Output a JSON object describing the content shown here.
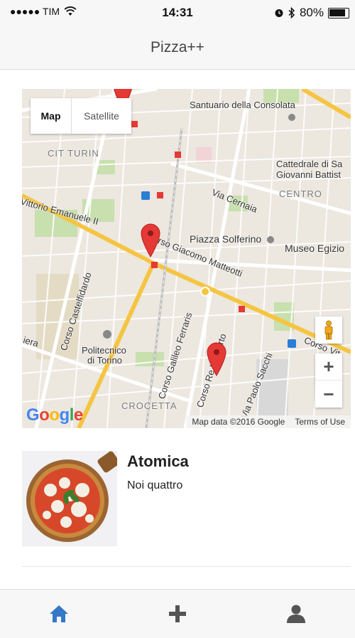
{
  "status_bar": {
    "signal": "●●●●● TIM",
    "time": "14:31",
    "battery": "80%"
  },
  "nav": {
    "title": "Pizza++"
  },
  "map": {
    "map_types": [
      "Map",
      "Satellite"
    ],
    "selected_type": "Map",
    "labels": {
      "consolata": "Santuario della Consolata",
      "cit_turin": "CIT TURIN",
      "cattedrale": "Cattedrale di Sa",
      "giovanni": "Giovanni Battist",
      "centro": "CENTRO",
      "cernaia": "Via Cernaia",
      "vittorio": "Vittorio Emanuele II",
      "solferino": "Piazza Solferino",
      "egizio": "Museo Egizio",
      "matteotti": "rso Giacomo Matteotti",
      "castelfidardo": "Corso Castelfidardo",
      "ferraris": "Corso Galileo Ferraris",
      "politecnico_1": "Politecnico",
      "politecnico_2": "di Torino",
      "crocetta": "CROCETTA",
      "re_umberto": "Corso Re Umberto",
      "sacchi": "Via Paolo Sacchi",
      "corso_vit": "Corso Vit",
      "iera": "iera"
    },
    "zoom_in": "+",
    "zoom_out": "−",
    "attribution": "Map data ©2016 Google",
    "terms": "Terms of Use",
    "logo_letters": [
      "G",
      "o",
      "o",
      "g",
      "l",
      "e"
    ]
  },
  "pizzerias": [
    {
      "name": "Atomica",
      "address": "Noi quattro"
    }
  ],
  "tabs": [
    {
      "icon": "home-icon",
      "active": true
    },
    {
      "icon": "plus-icon",
      "active": false
    },
    {
      "icon": "user-icon",
      "active": false
    }
  ],
  "colors": {
    "accent": "#3478c6",
    "tab_inactive": "#555555",
    "marker": "#e53935",
    "road_major": "#f5c542"
  }
}
